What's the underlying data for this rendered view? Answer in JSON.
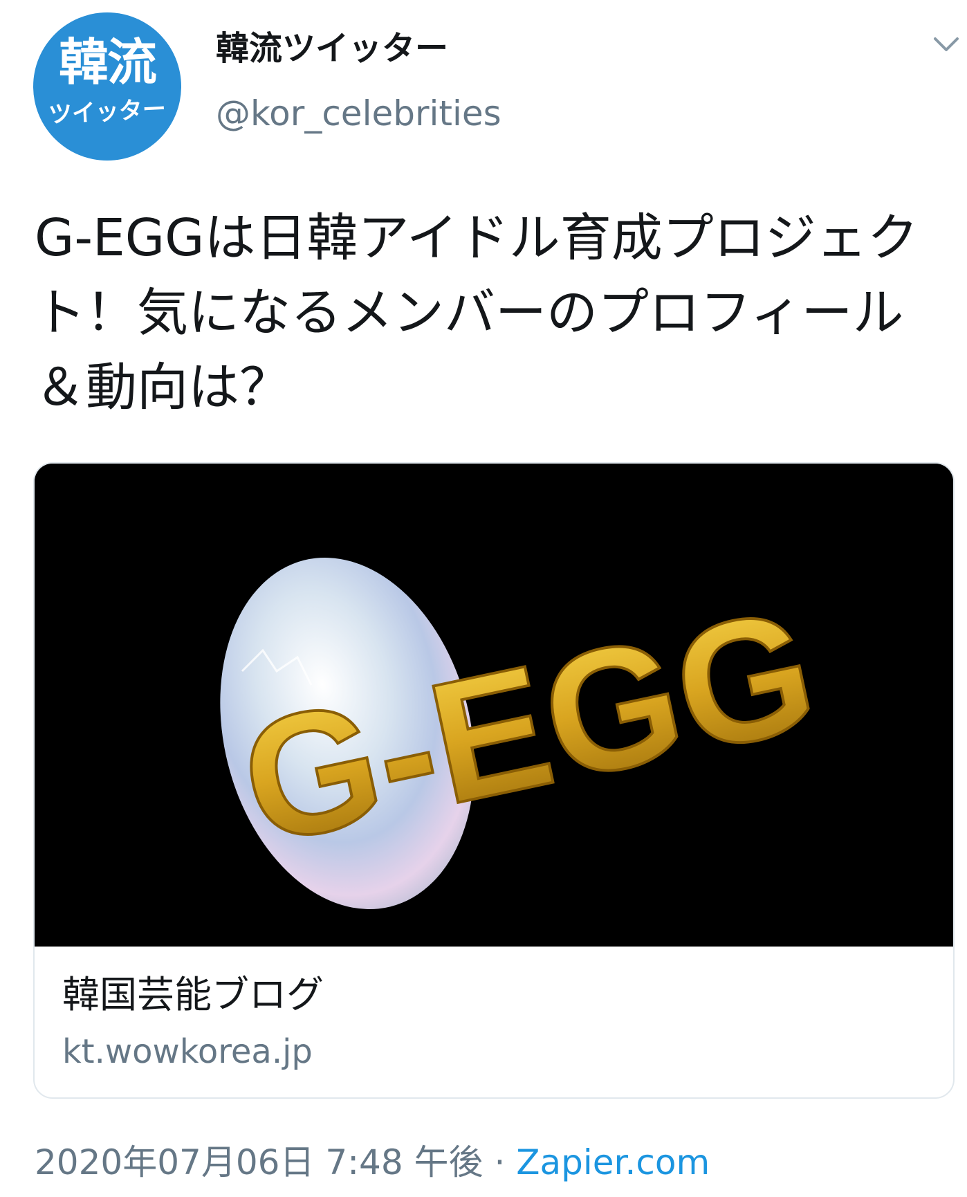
{
  "author": {
    "avatar_text_main": "韓流",
    "avatar_text_sub": "ツイッター",
    "avatar_color": "#2a8fd6",
    "display_name": "韓流ツイッター",
    "handle": "@kor_celebrities"
  },
  "tweet": {
    "text": "G-EGGは日韓アイドル育成プロジェクト！気になるメンバーのプロフィール＆動向は？"
  },
  "card": {
    "image_text": "G-EGG",
    "title": "韓国芸能ブログ",
    "domain": "kt.wowkorea.jp"
  },
  "meta": {
    "timestamp": "2020年07月06日 7:48 午後",
    "separator": " · ",
    "source": "Zapier.com"
  },
  "icons": {
    "menu": "chevron-down-icon"
  },
  "colors": {
    "link": "#1b95e0",
    "secondary_text": "#657786",
    "card_border": "#e1e8ed",
    "gold": "#d9a520"
  }
}
